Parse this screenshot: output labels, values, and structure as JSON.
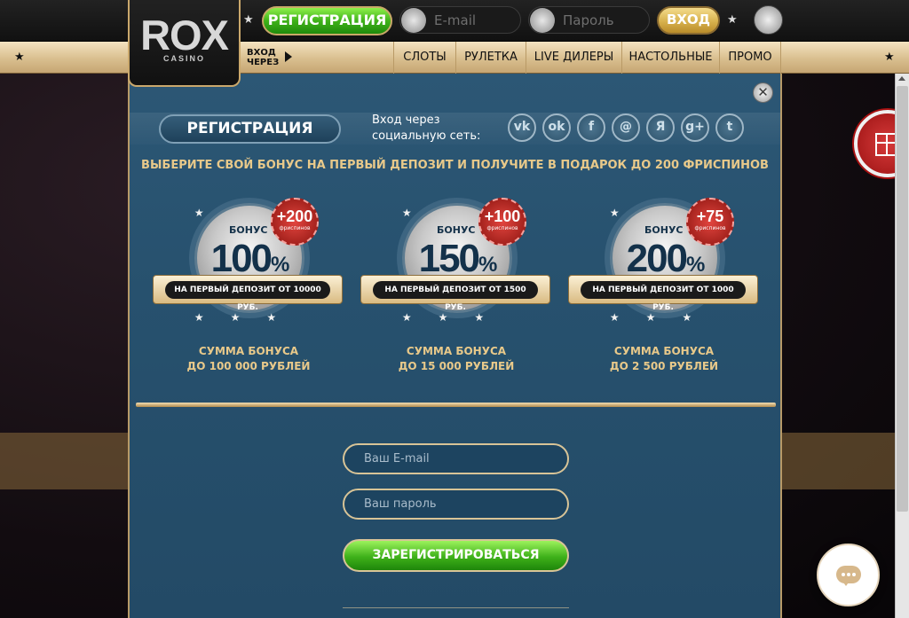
{
  "header": {
    "logo_text": "ROX",
    "logo_sub": "CASINO",
    "register_label": "РЕГИСТРАЦИЯ",
    "email_placeholder": "E-mail",
    "password_placeholder": "Пароль",
    "login_label": "ВХОД",
    "via_label_1": "ВХОД",
    "via_label_2": "ЧЕРЕЗ"
  },
  "nav": {
    "items": [
      "СЛОТЫ",
      "РУЛЕТКА",
      "LIVE ДИЛЕРЫ",
      "НАСТОЛЬНЫЕ",
      "ПРОМО"
    ]
  },
  "modal": {
    "title": "РЕГИСТРАЦИЯ",
    "social_label_1": "Вход через",
    "social_label_2": "социальную сеть:",
    "social_icons": [
      "vk-icon",
      "odnoklassniki-icon",
      "facebook-icon",
      "mailru-icon",
      "yandex-icon",
      "google-plus-icon",
      "twitter-icon"
    ],
    "bonus_heading": "ВЫБЕРИТЕ СВОЙ БОНУС НА ПЕРВЫЙ ДЕПОЗИТ И ПОЛУЧИТЕ В ПОДАРОК ДО 200 ФРИСПИНОВ",
    "bonuses": [
      {
        "word": "БОНУС",
        "percent": "100",
        "spins": "+200",
        "spins_label": "фриспинов",
        "ribbon": "НА  ПЕРВЫЙ ДЕПОЗИТ ОТ 10000 РУБ.",
        "sum_1": "СУММА БОНУСА",
        "sum_2": "ДО 100 000 РУБЛЕЙ"
      },
      {
        "word": "БОНУС",
        "percent": "150",
        "spins": "+100",
        "spins_label": "фриспинов",
        "ribbon": "НА  ПЕРВЫЙ ДЕПОЗИТ ОТ 1500 РУБ.",
        "sum_1": "СУММА БОНУСА",
        "sum_2": "ДО 15 000 РУБЛЕЙ"
      },
      {
        "word": "БОНУС",
        "percent": "200",
        "spins": "+75",
        "spins_label": "фриспинов",
        "ribbon": "НА  ПЕРВЫЙ ДЕПОЗИТ ОТ 1000 РУБ.",
        "sum_1": "СУММА БОНУСА",
        "sum_2": "ДО 2 500 РУБЛЕЙ"
      }
    ],
    "form": {
      "email_placeholder": "Ваш E-mail",
      "password_placeholder": "Ваш пароль",
      "submit_label": "ЗАРЕГИСТРИРОВАТЬСЯ"
    }
  },
  "colors": {
    "modal_bg": "#27516e",
    "gold": "#e8c98a",
    "green": "#3fb11a"
  }
}
